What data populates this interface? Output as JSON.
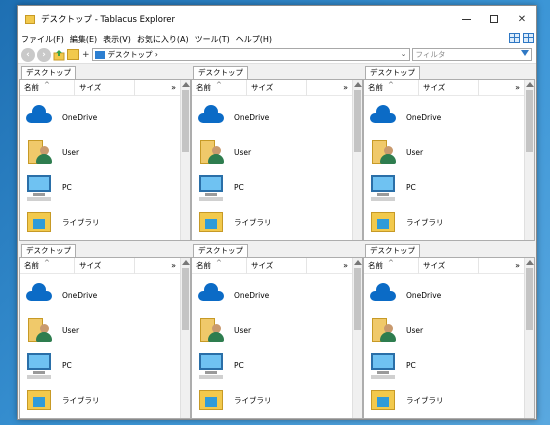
{
  "window": {
    "title": "デスクトップ - Tablacus Explorer"
  },
  "menu": [
    "ファイル(F)",
    "編集(E)",
    "表示(V)",
    "お気に入り(A)",
    "ツール(T)",
    "ヘルプ(H)"
  ],
  "toolbar": {
    "address": "デスクトップ ›",
    "filter_placeholder": "フィルタ"
  },
  "columns": {
    "name": "名前",
    "size": "サイズ",
    "more": "»"
  },
  "panes": [
    {
      "tab": "デスクトップ",
      "items": [
        {
          "label": "OneDrive"
        },
        {
          "label": "User"
        },
        {
          "label": "PC"
        },
        {
          "label": "ライブラリ"
        }
      ]
    },
    {
      "tab": "デスクトップ",
      "items": [
        {
          "label": "OneDrive"
        },
        {
          "label": "User"
        },
        {
          "label": "PC"
        },
        {
          "label": "ライブラリ"
        }
      ]
    },
    {
      "tab": "デスクトップ",
      "items": [
        {
          "label": "OneDrive"
        },
        {
          "label": "User"
        },
        {
          "label": "PC"
        },
        {
          "label": "ライブラリ"
        }
      ]
    },
    {
      "tab": "デスクトップ",
      "items": [
        {
          "label": "OneDrive"
        },
        {
          "label": "User"
        },
        {
          "label": "PC"
        },
        {
          "label": "ライブラリ"
        }
      ]
    },
    {
      "tab": "デスクトップ",
      "items": [
        {
          "label": "OneDrive"
        },
        {
          "label": "User"
        },
        {
          "label": "PC"
        },
        {
          "label": "ライブラリ"
        }
      ]
    },
    {
      "tab": "デスクトップ",
      "items": [
        {
          "label": "OneDrive"
        },
        {
          "label": "User"
        },
        {
          "label": "PC"
        },
        {
          "label": "ライブラリ"
        }
      ]
    }
  ]
}
